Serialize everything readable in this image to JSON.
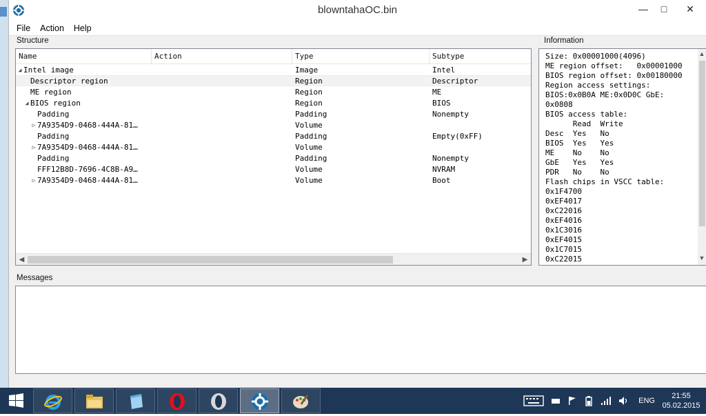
{
  "window": {
    "title": "blowntahaOC.bin",
    "minimize": "—",
    "maximize": "□",
    "close": "✕"
  },
  "menu": [
    "File",
    "Action",
    "Help"
  ],
  "structure": {
    "label": "Structure",
    "columns": {
      "name": "Name",
      "action": "Action",
      "type": "Type",
      "subtype": "Subtype"
    },
    "rows": [
      {
        "name": "Intel image",
        "type": "Image",
        "subtype": "Intel",
        "indent": 0,
        "arrow": "open"
      },
      {
        "name": "Descriptor region",
        "type": "Region",
        "subtype": "Descriptor",
        "indent": 1,
        "arrow": "none",
        "selected": true
      },
      {
        "name": "ME region",
        "type": "Region",
        "subtype": "ME",
        "indent": 1,
        "arrow": "none"
      },
      {
        "name": "BIOS region",
        "type": "Region",
        "subtype": "BIOS",
        "indent": 1,
        "arrow": "open"
      },
      {
        "name": "Padding",
        "type": "Padding",
        "subtype": "Nonempty",
        "indent": 2,
        "arrow": "none"
      },
      {
        "name": "7A9354D9-0468-444A-81…",
        "type": "Volume",
        "subtype": "",
        "indent": 2,
        "arrow": "closed"
      },
      {
        "name": "Padding",
        "type": "Padding",
        "subtype": "Empty(0xFF)",
        "indent": 2,
        "arrow": "none"
      },
      {
        "name": "7A9354D9-0468-444A-81…",
        "type": "Volume",
        "subtype": "",
        "indent": 2,
        "arrow": "closed"
      },
      {
        "name": "Padding",
        "type": "Padding",
        "subtype": "Nonempty",
        "indent": 2,
        "arrow": "none"
      },
      {
        "name": "FFF12B8D-7696-4C8B-A9…",
        "type": "Volume",
        "subtype": "NVRAM",
        "indent": 2,
        "arrow": "none"
      },
      {
        "name": "7A9354D9-0468-444A-81…",
        "type": "Volume",
        "subtype": "Boot",
        "indent": 2,
        "arrow": "closed"
      }
    ]
  },
  "information": {
    "label": "Information",
    "lines": [
      "Size: 0x00001000(4096)",
      "ME region offset:   0x00001000",
      "BIOS region offset: 0x00180000",
      "Region access settings:",
      "BIOS:0x0B0A ME:0x0D0C GbE:",
      "0x0808",
      "BIOS access table:",
      "      Read  Write",
      "Desc  Yes   No",
      "BIOS  Yes   Yes",
      "ME    No    No",
      "GbE   Yes   Yes",
      "PDR   No    No",
      "Flash chips in VSCC table:",
      "0x1F4700",
      "0xEF4017",
      "0xC22016",
      "0xEF4016",
      "0x1C3016",
      "0xEF4015",
      "0x1C7015",
      "0xC22015"
    ]
  },
  "messages": {
    "label": "Messages"
  },
  "taskbar": {
    "apps": [
      "internet-explorer",
      "file-explorer",
      "notepad",
      "opera",
      "opera-next",
      "uefitool",
      "paint"
    ],
    "active_app": "uefitool",
    "language": "ENG",
    "time": "21:55",
    "date": "05.02.2015"
  },
  "colors": {
    "taskbar": "#1e3756",
    "selection": "#f2f2f2",
    "panel_border": "#828790"
  }
}
